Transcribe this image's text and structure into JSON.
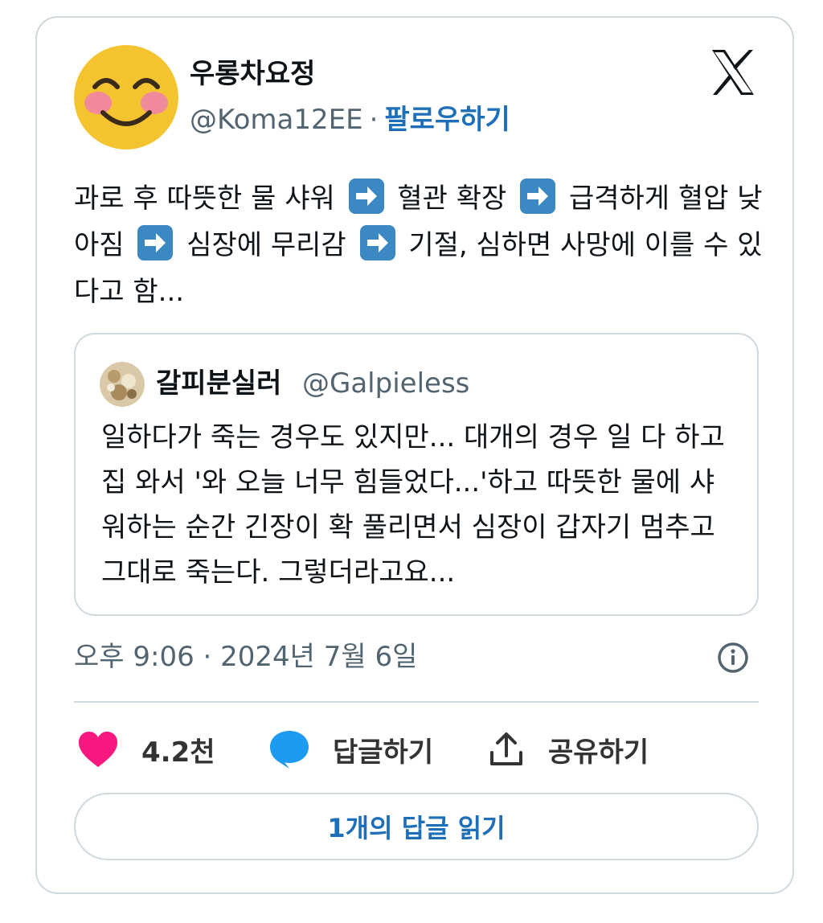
{
  "tweet": {
    "author": {
      "name": "우롱차요정",
      "handle": "@Koma12EE",
      "separator": "·",
      "follow_label": "팔로우하기"
    },
    "segments": [
      "과로 후 따뜻한 물 샤워",
      "혈관 확장",
      "급격하게 혈압 낮아짐",
      "심장에 무리감",
      "기절, 심하면 사망에 이를 수 있다고 함..."
    ],
    "arrow_emoji": "arrow-right-emoji",
    "quote": {
      "name": "갈피분실러",
      "handle": "@Galpieless",
      "text": "일하다가 죽는 경우도 있지만... 대개의 경우 일 다 하고 집 와서 '와 오늘 너무 힘들었다...'하고 따뜻한 물에 샤워하는 순간 긴장이 확 풀리면서 심장이 갑자기 멈추고 그대로 죽는다. 그렇더라고요..."
    },
    "timestamp": "오후 9:06 · 2024년 7월 6일",
    "actions": {
      "likes": "4.2천",
      "reply_label": "답글하기",
      "share_label": "공유하기"
    },
    "read_replies_label": "1개의 답글 읽기"
  },
  "colors": {
    "accent": "#1d6fb8",
    "like": "#f91880",
    "reply": "#1d9bf0",
    "border": "#cfd9de",
    "muted": "#536471"
  }
}
